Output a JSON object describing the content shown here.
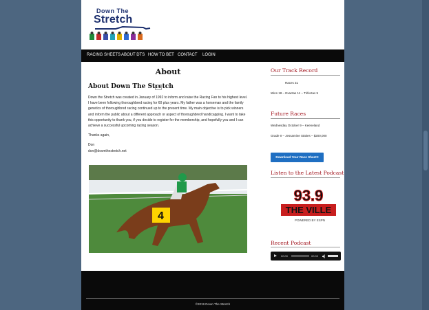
{
  "logo": {
    "line1": "Down The",
    "line2": "Stretch"
  },
  "nav": [
    "RACING SHEETS",
    "ABOUT DTS",
    "HOW TO BET",
    "CONTACT",
    "LOGIN"
  ],
  "main": {
    "title": "About",
    "heading": "About Down The Stretch",
    "edit_icon_text": "0",
    "paragraph": "Down the Stretch was created in January of 1992 to inform and raise the Racing Fan to his highest level. I have been following thoroughbred racing for 60 plus years. My father was a horseman and the family genetics of thoroughbred racing continued up to the present time. My main objective is to pick winners and inform the public about a different approach or aspect of thoroughbred handicapping. I want to take this opportunity to thank you, if you decide to register for the membership, and hopefully you and I can achieve a successful upcoming racing season.",
    "thanks": "Thanks again,",
    "sign_name": "Don",
    "sign_email": "don@downthestretch.net",
    "photo_saddle_number": "4"
  },
  "sidebar": {
    "track_title": "Our Track Record",
    "races": "Races 31",
    "wins": "Wins 18 – Exactas 11 – Trifectas 5",
    "future_title": "Future Races",
    "future_1": "Wednesday October 9 – Keeneland",
    "future_2": "Grade II – Jessamine Stakes – $200,000",
    "button": "Download Your Race Sheet!!",
    "podcast_title": "Listen to the Latest Podcast",
    "radio_top": "93.9",
    "radio_name": "THE VILLE",
    "radio_sub": "POWERED BY ESPN",
    "recent_title": "Recent Podcast",
    "player_time_start": "00:00",
    "player_time_end": "00:00"
  },
  "footer": {
    "copyright": "©2019 Down The Stretch"
  },
  "colors": {
    "accent": "#a2161f",
    "button": "#1f6fc2",
    "nav_bg": "#0a0a0a",
    "page_bg": "#4d6680"
  }
}
